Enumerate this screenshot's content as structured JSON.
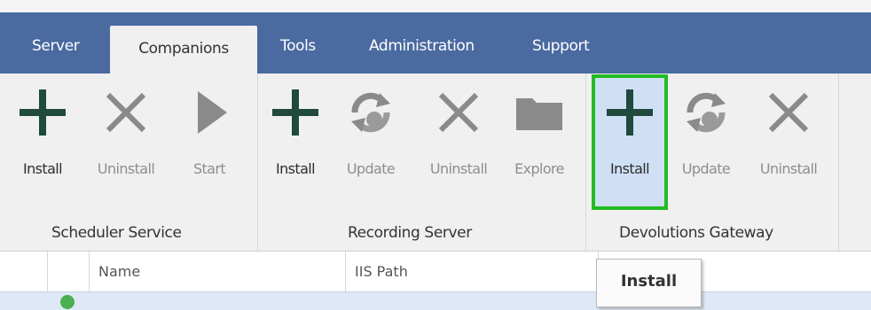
{
  "tabs": [
    {
      "label": "Server"
    },
    {
      "label": "Companions",
      "active": true
    },
    {
      "label": "Tools"
    },
    {
      "label": "Administration"
    },
    {
      "label": "Support"
    }
  ],
  "ribbon": {
    "groups": [
      {
        "label": "Scheduler Service",
        "buttons": [
          {
            "label": "Install",
            "icon": "plus-icon",
            "enabled": true
          },
          {
            "label": "Uninstall",
            "icon": "x-icon",
            "enabled": false
          },
          {
            "label": "Start",
            "icon": "play-icon",
            "enabled": false
          }
        ]
      },
      {
        "label": "Recording Server",
        "buttons": [
          {
            "label": "Install",
            "icon": "plus-icon",
            "enabled": true
          },
          {
            "label": "Update",
            "icon": "update-globe-icon",
            "enabled": false
          },
          {
            "label": "Uninstall",
            "icon": "x-icon",
            "enabled": false
          },
          {
            "label": "Explore",
            "icon": "folder-icon",
            "enabled": false
          }
        ]
      },
      {
        "label": "Devolutions Gateway",
        "buttons": [
          {
            "label": "Install",
            "icon": "plus-icon",
            "enabled": true,
            "highlighted": true
          },
          {
            "label": "Update",
            "icon": "update-globe-icon",
            "enabled": false
          },
          {
            "label": "Uninstall",
            "icon": "x-icon",
            "enabled": false
          }
        ]
      }
    ]
  },
  "grid": {
    "columns": [
      "Name",
      "IIS Path"
    ]
  },
  "tooltip": {
    "text": "Install"
  },
  "colors": {
    "tab_strip": "#4a6aa0",
    "plus": "#1f4a3d",
    "highlight_border": "#22bb22",
    "highlight_fill": "#cfe0f4"
  }
}
